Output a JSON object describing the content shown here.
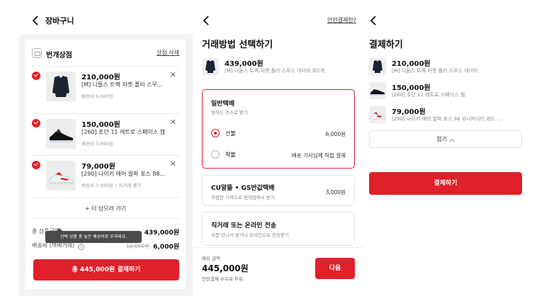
{
  "cart": {
    "title": "장바구니",
    "shop_name": "번개상점",
    "shop_delete": "상점 삭제",
    "items": [
      {
        "price": "210,000원",
        "name": "[M] 니들스 트랙 자켓 폴리 스무...",
        "shipping": "배송비 6,000원"
      },
      {
        "price": "150,000원",
        "name": "[260] 조던 11 레트로 스페이스 잼",
        "shipping": "배송비 3,000원"
      },
      {
        "price": "79,000원",
        "name": "[290] 나이키 에어 알파 포스 88...",
        "shipping": "배송비 3,000원 • 직거래 불가"
      }
    ],
    "add_more": "+ 더 담으러 가기",
    "total_label": "총 상품금액",
    "total_value": "439,000원",
    "shipping_label": "배송비 (택배거래)",
    "shipping_original": "12,000원",
    "shipping_value": "6,000원",
    "tooltip": "선택 상품 중 높은 배송비로 부과돼요.",
    "pay_button": "총 445,000원 결제하기"
  },
  "method": {
    "title": "거래방법 선택하기",
    "safe_link": "안전결제란?",
    "product_price": "439,000원",
    "product_name": "[M] 니들스 트랙 자켓 폴리 스무스 네이비 외2개",
    "general": {
      "title": "일반택배",
      "subtitle": "원하는 주소로 받기",
      "prepaid_label": "선불",
      "prepaid_value": "6,000원",
      "collect_label": "착불",
      "collect_value": "배송 기사님께 직접 결제"
    },
    "cu": {
      "title": "CU알뜰 • GS반값택배",
      "subtitle": "저렴한 가격으로 편의점에서 받기",
      "value": "3,000원"
    },
    "direct": {
      "title": "직거래 또는 온라인 전송",
      "subtitle": "직접 만나서 받거나 온라인으로 전송받기"
    },
    "estimate_label": "예상 금액",
    "estimate_value": "445,000원",
    "estimate_sub": "안전결제 수수료 무료",
    "next_button": "다음"
  },
  "payment": {
    "title": "결제하기",
    "items": [
      {
        "price": "210,000원",
        "name": "[M] 니들스 트랙 자켓 폴리 스무스 네이비"
      },
      {
        "price": "150,000원",
        "name": "[260] 조던 11 레트로 스페이스 잼"
      },
      {
        "price": "79,000원",
        "name": "[290] 나이키 에어 알파 포스 88 유니버시티 레드 ..."
      }
    ],
    "fold_label": "접기 ︿",
    "pay_button": "결제하기"
  },
  "colors": {
    "accent": "#e0202a",
    "panel_bg": "#f3f3f3"
  }
}
